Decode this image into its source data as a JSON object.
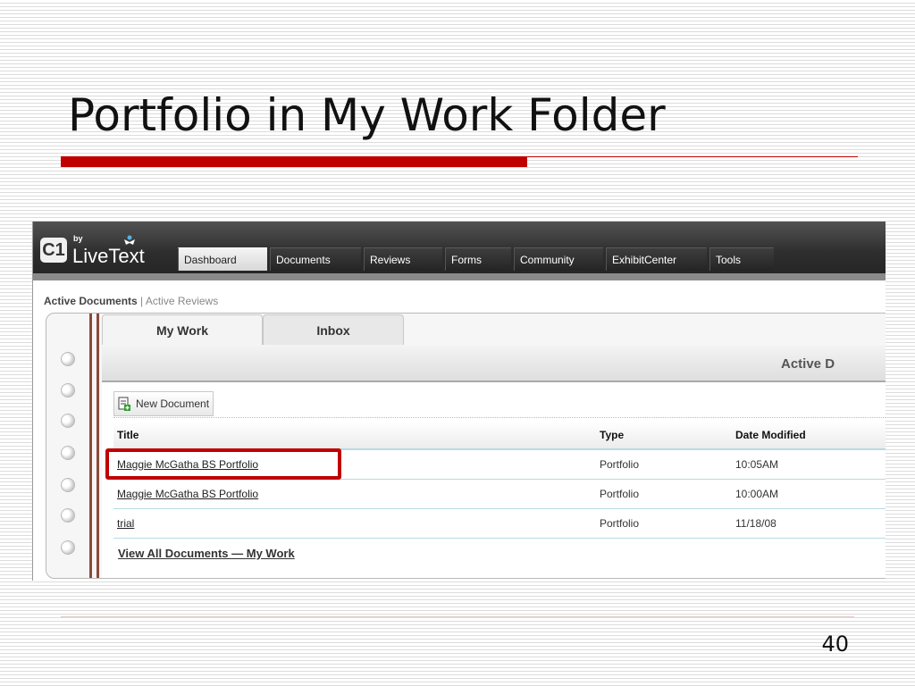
{
  "slide": {
    "title": "Portfolio in My Work Folder",
    "page_number": "40",
    "accent_color": "#c00000"
  },
  "app": {
    "logo": {
      "mark": "C1",
      "by": "by",
      "name": "LiveText",
      "icon": "person-figure-icon"
    },
    "nav_tabs": [
      {
        "label": "Dashboard",
        "active": true
      },
      {
        "label": "Documents",
        "active": false
      },
      {
        "label": "Reviews",
        "active": false
      },
      {
        "label": "Forms",
        "active": false
      },
      {
        "label": "Community",
        "active": false
      },
      {
        "label": "ExhibitCenter",
        "active": false
      },
      {
        "label": "Tools",
        "active": false
      }
    ],
    "breadcrumb": {
      "active": "Active Documents",
      "separator": "|",
      "other": "Active Reviews"
    },
    "folder_tabs": [
      {
        "label": "My Work",
        "active": true
      },
      {
        "label": "Inbox",
        "active": false
      }
    ],
    "section_heading": "Active D",
    "new_document_label": "New Document",
    "table": {
      "columns": [
        "Title",
        "Type",
        "Date Modified"
      ],
      "rows": [
        {
          "title": "Maggie McGatha BS Portfolio",
          "type": "Portfolio",
          "date": "10:05AM"
        },
        {
          "title": "Maggie McGatha BS Portfolio",
          "type": "Portfolio",
          "date": "10:00AM"
        },
        {
          "title": "trial",
          "type": "Portfolio",
          "date": "11/18/08"
        }
      ]
    },
    "view_all_label": "View All Documents — My Work"
  }
}
